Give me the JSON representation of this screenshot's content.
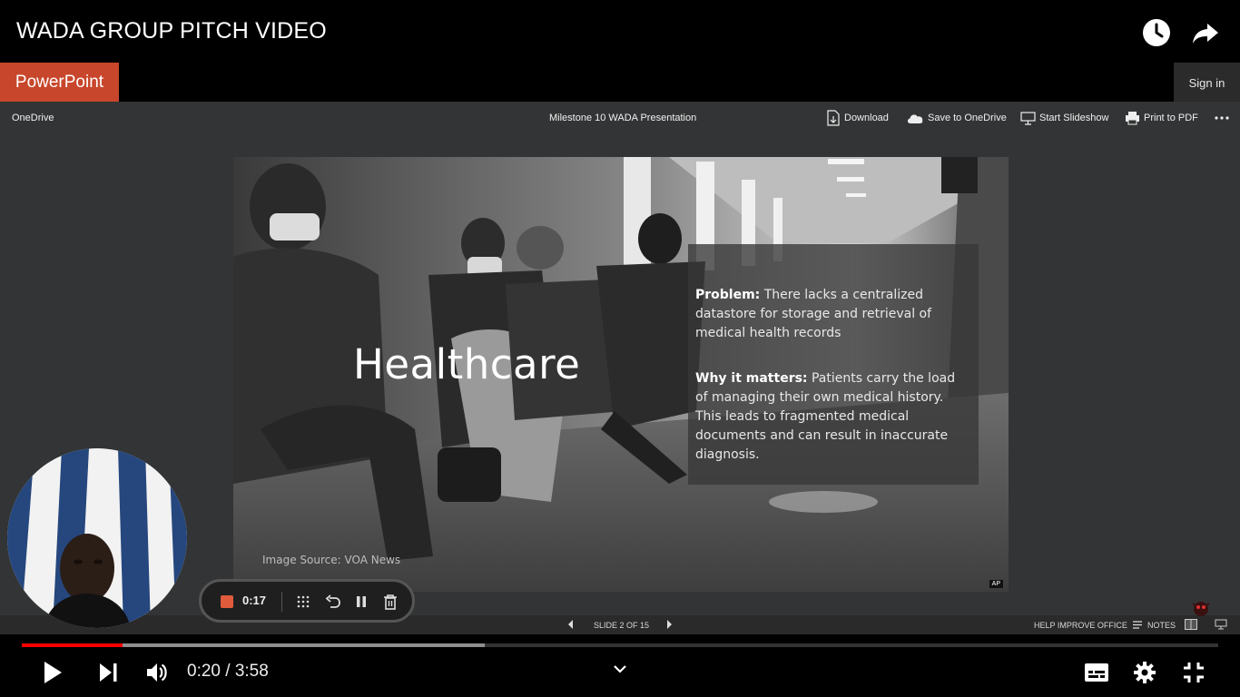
{
  "video": {
    "title": "WADA GROUP PITCH VIDEO",
    "time_current": "0:20",
    "time_separator": " / ",
    "time_total": "3:58",
    "played_fraction": 0.084,
    "buffered_fraction": 0.387,
    "progress_color": "#ff0000"
  },
  "top_icons": [
    "watch-later-icon",
    "share-icon"
  ],
  "powerpoint": {
    "brand": "PowerPoint",
    "brand_color": "#c8462b",
    "sign_in": "Sign in",
    "breadcrumb": "OneDrive",
    "doc_title": "Milestone 10 WADA Presentation",
    "commands": {
      "download": "Download",
      "save": "Save to OneDrive",
      "slideshow": "Start Slideshow",
      "print": "Print to PDF"
    },
    "status": {
      "slide_indicator": "SLIDE 2 OF 15",
      "help": "HELP IMPROVE OFFICE",
      "notes": "NOTES"
    }
  },
  "slide": {
    "title": "Healthcare",
    "problem_label": "Problem:",
    "problem_text": " There lacks a centralized datastore for storage and retrieval of medical health records",
    "why_label": "Why it matters:",
    "why_text": " Patients carry the load of managing their own medical history. This leads to fragmented medical documents and can result in inaccurate diagnosis.",
    "image_source": "Image Source: VOA News",
    "badge": "AP"
  },
  "recorder": {
    "elapsed": "0:17",
    "stop_color": "#e05a3c"
  }
}
